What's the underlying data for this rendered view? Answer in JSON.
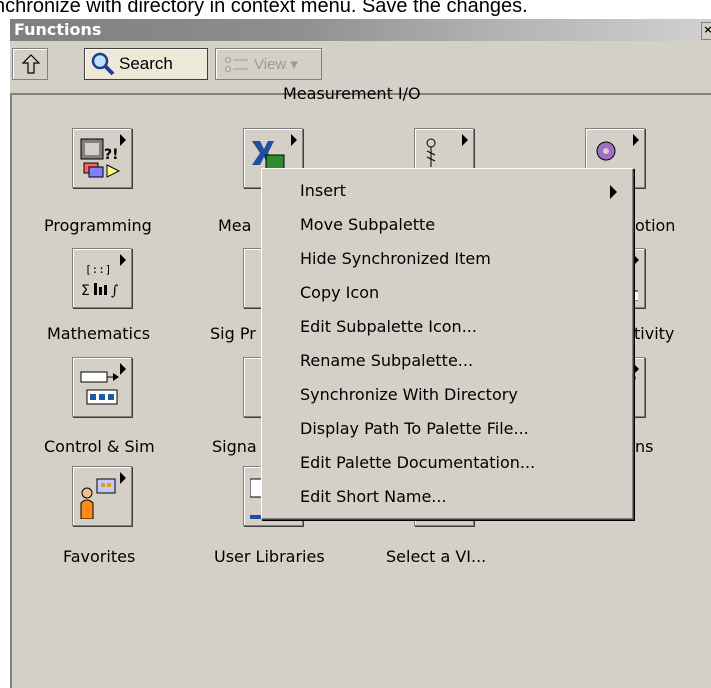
{
  "instruction": "nchronize with directory in context menu. Save the changes.",
  "window": {
    "title": "Functions",
    "close_glyph": "×"
  },
  "toolbar": {
    "search_label": "Search",
    "view_label": "View ▾"
  },
  "palette": {
    "title": "Measurement I/O",
    "items": [
      {
        "label": "Programming",
        "icon": "programming-icon"
      },
      {
        "label": "Mea",
        "icon": "measurement-io-icon"
      },
      {
        "label": "otion",
        "icon": "motion-icon"
      },
      {
        "label": "Mathematics",
        "icon": "mathematics-icon"
      },
      {
        "label": "Sig Pr",
        "icon": "signal-processing-icon"
      },
      {
        "label": "tivity",
        "icon": "connectivity-icon"
      },
      {
        "label": "Control & Sim",
        "icon": "control-sim-icon"
      },
      {
        "label": "Signa",
        "icon": "signal-icon"
      },
      {
        "label": "ns",
        "icon": "express-icon"
      },
      {
        "label": "Favorites",
        "icon": "favorites-icon"
      },
      {
        "label": "User Libraries",
        "icon": "user-libraries-icon"
      },
      {
        "label": "Select a VI...",
        "icon": "select-vi-icon"
      }
    ]
  },
  "context_menu": {
    "items": [
      "Insert",
      "Move Subpalette",
      "Hide Synchronized Item",
      "Copy Icon",
      "Edit Subpalette Icon...",
      "Rename Subpalette...",
      "Synchronize With Directory",
      "Display Path To Palette File...",
      "Edit Palette Documentation...",
      "Edit Short Name..."
    ]
  }
}
